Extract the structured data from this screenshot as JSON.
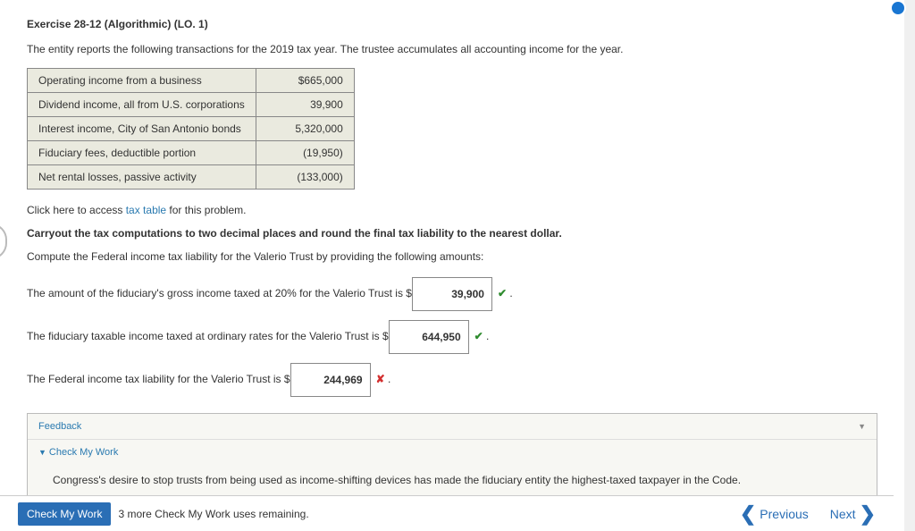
{
  "title": "Exercise 28-12 (Algorithmic) (LO. 1)",
  "intro": "The entity reports the following transactions for the 2019 tax year. The trustee accumulates all accounting income for the year.",
  "table": {
    "rows": [
      {
        "label": "Operating income from a business",
        "value": "$665,000"
      },
      {
        "label": "Dividend income, all from U.S. corporations",
        "value": "39,900"
      },
      {
        "label": "Interest income, City of San Antonio bonds",
        "value": "5,320,000"
      },
      {
        "label": "Fiduciary fees, deductible portion",
        "value": "(19,950)"
      },
      {
        "label": "Net rental losses, passive activity",
        "value": "(133,000)"
      }
    ]
  },
  "access_prefix": "Click here to access ",
  "tax_table_link": "tax table",
  "access_suffix": " for this problem.",
  "bold_instruction": "Carryout the tax computations to two decimal places and round the final tax liability to the nearest dollar.",
  "compute_instruction": "Compute the Federal income tax liability for the Valerio Trust by providing the following amounts:",
  "q1": {
    "prefix": "The amount of the fiduciary's gross income taxed at 20% for the Valerio Trust is $",
    "value": "39,900",
    "mark": "✔",
    "suffix": "."
  },
  "q2": {
    "prefix": "The fiduciary taxable income taxed at ordinary rates for the Valerio Trust is $",
    "value": "644,950",
    "mark": "✔",
    "suffix": "."
  },
  "q3": {
    "prefix": "The Federal income tax liability for the Valerio Trust is $",
    "value": "244,969",
    "mark": "✘",
    "suffix": "."
  },
  "feedback": {
    "label": "Feedback",
    "check_my_work_label": "Check My Work",
    "body": "Congress's desire to stop trusts from being used as income-shifting devices has made the fiduciary entity the highest-taxed taxpayer in the Code."
  },
  "bottom": {
    "check_button": "Check My Work",
    "remaining": "3 more Check My Work uses remaining.",
    "previous": "Previous",
    "next": "Next"
  }
}
